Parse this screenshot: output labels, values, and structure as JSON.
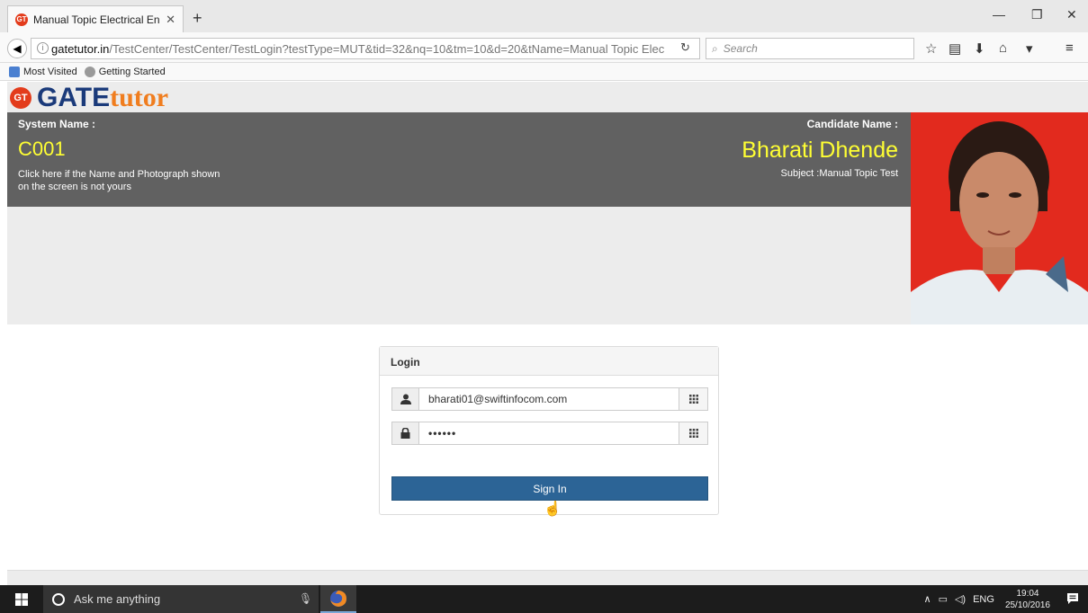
{
  "browser": {
    "tab_title": "Manual Topic Electrical En...",
    "tab_favicon": "GT",
    "url_host": "gatetutor.in",
    "url_path": "/TestCenter/TestCenter/TestLogin?testType=MUT&tid=32&nq=10&tm=10&d=20&tName=Manual Topic Elec",
    "search_placeholder": "Search",
    "bookmarks": [
      "Most Visited",
      "Getting Started"
    ]
  },
  "logo": {
    "badge": "GT",
    "gate": "GATE",
    "tutor": "tutor"
  },
  "header": {
    "system_label": "System Name :",
    "system_value": "C001",
    "system_note": "Click here if the Name and Photograph shown on the screen is not yours",
    "candidate_label": "Candidate Name :",
    "candidate_value": "Bharati Dhende",
    "subject": "Subject :Manual Topic Test"
  },
  "login": {
    "title": "Login",
    "username": "bharati01@swiftinfocom.com",
    "password": "••••••",
    "signin_label": "Sign In"
  },
  "taskbar": {
    "search_placeholder": "Ask me anything",
    "language": "ENG",
    "time": "19:04",
    "date": "25/10/2016"
  },
  "colors": {
    "header_bg": "#616161",
    "highlight_yellow": "#ffff33",
    "signin_blue": "#2c6496",
    "logo_blue": "#1a3a7a",
    "logo_orange": "#f07d1e",
    "photo_red": "#e22a1e"
  }
}
